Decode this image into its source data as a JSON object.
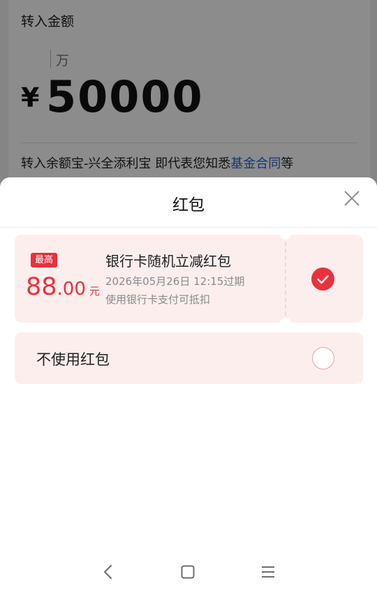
{
  "background": {
    "title": "转入金额",
    "unit": "万",
    "currency": "¥",
    "amount": "50000",
    "terms_prefix": "转入余额宝-兴全添利宝 即代表您知悉",
    "terms_link": "基金合同",
    "terms_suffix": "等"
  },
  "sheet": {
    "title": "红包",
    "close_icon": "close-icon"
  },
  "coupon": {
    "badge": "最高",
    "amount_int": "88",
    "amount_dec": ".00",
    "amount_unit": "元",
    "title": "银行卡随机立减红包",
    "expiry": "2026年05月26日 12:15过期",
    "description": "使用银行卡支付可抵扣",
    "selected": true
  },
  "no_coupon": {
    "label": "不使用红包",
    "selected": false
  },
  "nav": {
    "back_icon": "back-icon",
    "home_icon": "home-icon",
    "menu_icon": "menu-icon"
  },
  "colors": {
    "accent": "#e8323e",
    "card_bg": "#fdeeee",
    "link": "#2a5fd1"
  }
}
